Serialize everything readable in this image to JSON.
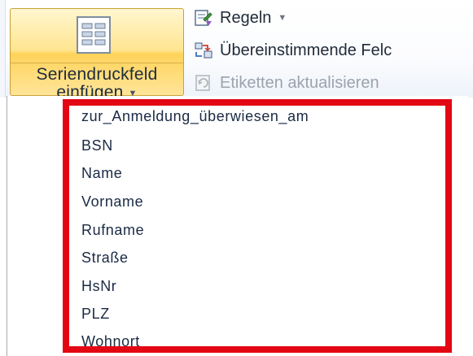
{
  "ribbon": {
    "big_button": {
      "label_line1": "Seriendruckfeld",
      "label_line2": "einfügen",
      "icon": "document-fields-icon"
    },
    "commands": [
      {
        "label": "Regeln",
        "icon": "rules-icon",
        "has_dropdown": true,
        "enabled": true
      },
      {
        "label": "Übereinstimmende Felc",
        "icon": "match-fields-icon",
        "has_dropdown": false,
        "enabled": true
      },
      {
        "label": "Etiketten aktualisieren",
        "icon": "update-labels-icon",
        "has_dropdown": false,
        "enabled": false
      }
    ]
  },
  "menu": {
    "items": [
      "zur_Anmeldung_überwiesen_am",
      "BSN",
      "Name",
      "Vorname",
      "Rufname",
      "Straße",
      "HsNr",
      "PLZ",
      "Wohnort"
    ]
  },
  "colors": {
    "highlight": "#e30613",
    "button_active": "#ffd35a"
  }
}
